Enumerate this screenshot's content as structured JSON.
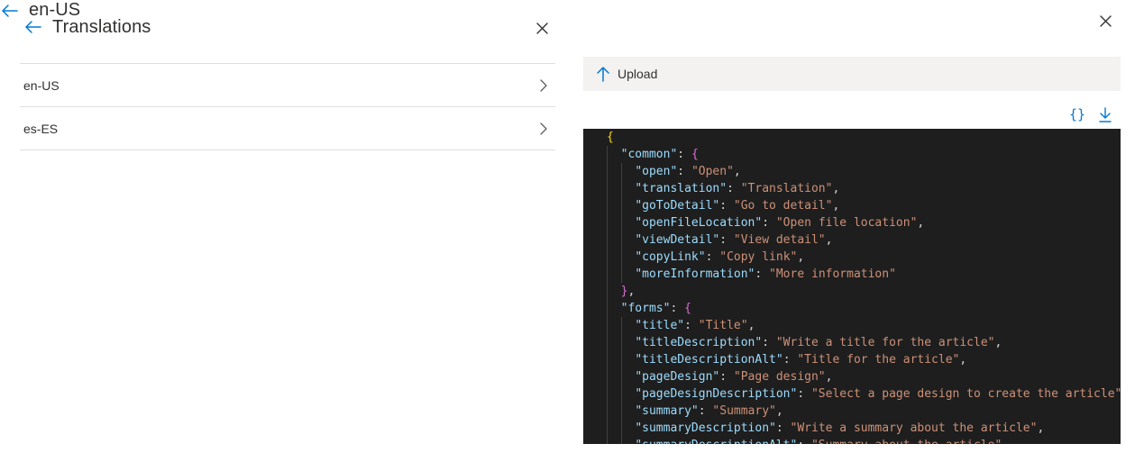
{
  "left_panel": {
    "title": "Translations",
    "items": [
      {
        "label": "en-US"
      },
      {
        "label": "es-ES"
      }
    ]
  },
  "right_panel": {
    "title": "en-US",
    "upload_label": "Upload",
    "format_icon": "{}",
    "code_lines": [
      {
        "indent": 0,
        "tokens": [
          {
            "t": "{",
            "c": "b1"
          }
        ]
      },
      {
        "indent": 1,
        "tokens": [
          {
            "t": "\"common\"",
            "c": "k"
          },
          {
            "t": ": ",
            "c": "p"
          },
          {
            "t": "{",
            "c": "b2"
          }
        ]
      },
      {
        "indent": 2,
        "tokens": [
          {
            "t": "\"open\"",
            "c": "k"
          },
          {
            "t": ": ",
            "c": "p"
          },
          {
            "t": "\"Open\"",
            "c": "s"
          },
          {
            "t": ",",
            "c": "p"
          }
        ]
      },
      {
        "indent": 2,
        "tokens": [
          {
            "t": "\"translation\"",
            "c": "k"
          },
          {
            "t": ": ",
            "c": "p"
          },
          {
            "t": "\"Translation\"",
            "c": "s"
          },
          {
            "t": ",",
            "c": "p"
          }
        ]
      },
      {
        "indent": 2,
        "tokens": [
          {
            "t": "\"goToDetail\"",
            "c": "k"
          },
          {
            "t": ": ",
            "c": "p"
          },
          {
            "t": "\"Go to detail\"",
            "c": "s"
          },
          {
            "t": ",",
            "c": "p"
          }
        ]
      },
      {
        "indent": 2,
        "tokens": [
          {
            "t": "\"openFileLocation\"",
            "c": "k"
          },
          {
            "t": ": ",
            "c": "p"
          },
          {
            "t": "\"Open file location\"",
            "c": "s"
          },
          {
            "t": ",",
            "c": "p"
          }
        ]
      },
      {
        "indent": 2,
        "tokens": [
          {
            "t": "\"viewDetail\"",
            "c": "k"
          },
          {
            "t": ": ",
            "c": "p"
          },
          {
            "t": "\"View detail\"",
            "c": "s"
          },
          {
            "t": ",",
            "c": "p"
          }
        ]
      },
      {
        "indent": 2,
        "tokens": [
          {
            "t": "\"copyLink\"",
            "c": "k"
          },
          {
            "t": ": ",
            "c": "p"
          },
          {
            "t": "\"Copy link\"",
            "c": "s"
          },
          {
            "t": ",",
            "c": "p"
          }
        ]
      },
      {
        "indent": 2,
        "tokens": [
          {
            "t": "\"moreInformation\"",
            "c": "k"
          },
          {
            "t": ": ",
            "c": "p"
          },
          {
            "t": "\"More information\"",
            "c": "s"
          }
        ]
      },
      {
        "indent": 1,
        "tokens": [
          {
            "t": "}",
            "c": "b2"
          },
          {
            "t": ",",
            "c": "p"
          }
        ]
      },
      {
        "indent": 1,
        "tokens": [
          {
            "t": "\"forms\"",
            "c": "k"
          },
          {
            "t": ": ",
            "c": "p"
          },
          {
            "t": "{",
            "c": "b2"
          }
        ]
      },
      {
        "indent": 2,
        "tokens": [
          {
            "t": "\"title\"",
            "c": "k"
          },
          {
            "t": ": ",
            "c": "p"
          },
          {
            "t": "\"Title\"",
            "c": "s"
          },
          {
            "t": ",",
            "c": "p"
          }
        ]
      },
      {
        "indent": 2,
        "tokens": [
          {
            "t": "\"titleDescription\"",
            "c": "k"
          },
          {
            "t": ": ",
            "c": "p"
          },
          {
            "t": "\"Write a title for the article\"",
            "c": "s"
          },
          {
            "t": ",",
            "c": "p"
          }
        ]
      },
      {
        "indent": 2,
        "tokens": [
          {
            "t": "\"titleDescriptionAlt\"",
            "c": "k"
          },
          {
            "t": ": ",
            "c": "p"
          },
          {
            "t": "\"Title for the article\"",
            "c": "s"
          },
          {
            "t": ",",
            "c": "p"
          }
        ]
      },
      {
        "indent": 2,
        "tokens": [
          {
            "t": "\"pageDesign\"",
            "c": "k"
          },
          {
            "t": ": ",
            "c": "p"
          },
          {
            "t": "\"Page design\"",
            "c": "s"
          },
          {
            "t": ",",
            "c": "p"
          }
        ]
      },
      {
        "indent": 2,
        "tokens": [
          {
            "t": "\"pageDesignDescription\"",
            "c": "k"
          },
          {
            "t": ": ",
            "c": "p"
          },
          {
            "t": "\"Select a page design to create the article\"",
            "c": "s"
          },
          {
            "t": ",",
            "c": "p"
          }
        ]
      },
      {
        "indent": 2,
        "tokens": [
          {
            "t": "\"summary\"",
            "c": "k"
          },
          {
            "t": ": ",
            "c": "p"
          },
          {
            "t": "\"Summary\"",
            "c": "s"
          },
          {
            "t": ",",
            "c": "p"
          }
        ]
      },
      {
        "indent": 2,
        "tokens": [
          {
            "t": "\"summaryDescription\"",
            "c": "k"
          },
          {
            "t": ": ",
            "c": "p"
          },
          {
            "t": "\"Write a summary about the article\"",
            "c": "s"
          },
          {
            "t": ",",
            "c": "p"
          }
        ]
      },
      {
        "indent": 2,
        "tokens": [
          {
            "t": "\"summaryDescriptionAlt\"",
            "c": "k"
          },
          {
            "t": ": ",
            "c": "p"
          },
          {
            "t": "\"Summary about the article\"",
            "c": "s"
          }
        ]
      }
    ]
  },
  "colors": {
    "accent": "#0078d4",
    "editor_bg": "#1e1e1e",
    "json_key": "#9cdcfe",
    "json_string": "#ce9178",
    "bracket_level1": "#ffd700",
    "bracket_level2": "#da70d6"
  },
  "icons": {
    "back": "arrow-left-icon",
    "close": "close-icon",
    "chevron": "chevron-right-icon",
    "upload": "arrow-up-icon",
    "format": "braces-icon",
    "download": "download-icon"
  }
}
